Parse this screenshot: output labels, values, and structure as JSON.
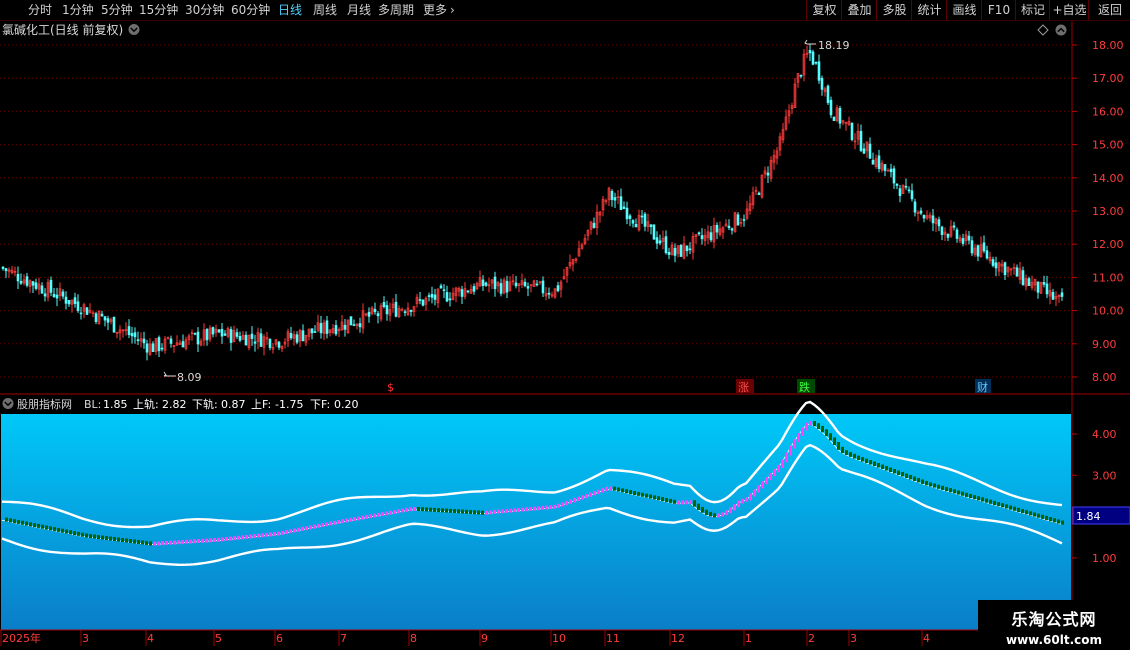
{
  "toolbar": {
    "periods": [
      "分时",
      "1分钟",
      "5分钟",
      "15分钟",
      "30分钟",
      "60分钟",
      "日线",
      "周线",
      "月线",
      "多周期",
      "更多"
    ],
    "active_period": "日线",
    "right_buttons": [
      "复权",
      "叠加",
      "多股",
      "统计",
      "画线",
      "F10",
      "标记",
      "+自选",
      "返回"
    ]
  },
  "main_chart": {
    "title": "氯碱化工(日线 前复权)",
    "high_label": "18.19",
    "low_label": "8.09",
    "y_ticks": [
      "18.00",
      "17.00",
      "16.00",
      "15.00",
      "14.00",
      "13.00",
      "12.00",
      "11.00",
      "10.00",
      "9.00",
      "8.00"
    ],
    "markers": [
      "$",
      "涨",
      "跌",
      "财"
    ],
    "up_color": "#ff3c3c",
    "down_color": "#54fcfc"
  },
  "indicator": {
    "name": "股朋指标网",
    "bl_label": "BL:",
    "bl_value": "1.85",
    "upper_label": "上轨:",
    "upper_value": "2.82",
    "lower_label": "下轨:",
    "lower_value": "0.87",
    "upf_label": "上F:",
    "upf_value": "-1.75",
    "downf_label": "下F:",
    "downf_value": "0.20",
    "y_ticks": [
      "4.00",
      "3.00",
      "1.00"
    ],
    "current_value": "1.84",
    "brick_up_color": "#ff40ff",
    "brick_down_color": "#006400",
    "bg_top": "#00c8f8",
    "bg_bottom": "#0a7ec8"
  },
  "x_axis": {
    "labels": [
      "2025年",
      "3",
      "4",
      "5",
      "6",
      "7",
      "8",
      "9",
      "10",
      "11",
      "12",
      "1",
      "2",
      "3",
      "4"
    ]
  },
  "watermark": {
    "name": "乐淘公式网",
    "url": "www.60lt.com"
  },
  "chart_data": {
    "type": "candlestick",
    "title": "氯碱化工(日线 前复权)",
    "y_range": [
      8.0,
      18.0
    ],
    "close_path": [
      {
        "month": "2025年",
        "close": 11.3
      },
      {
        "month": "3",
        "close": 10.1
      },
      {
        "month": "4",
        "close": 8.9
      },
      {
        "month": "5",
        "close": 9.3
      },
      {
        "month": "6",
        "close": 9.1
      },
      {
        "month": "7",
        "close": 9.6
      },
      {
        "month": "8",
        "close": 10.2
      },
      {
        "month": "9",
        "close": 10.8
      },
      {
        "month": "10",
        "close": 10.6
      },
      {
        "month": "11",
        "close": 13.5
      },
      {
        "month": "12",
        "close": 11.7
      },
      {
        "month": "1",
        "close": 12.9
      },
      {
        "month": "2",
        "close": 16.8
      },
      {
        "month": "3",
        "close": 15.3
      },
      {
        "month": "4",
        "close": 12.8
      }
    ],
    "high": 18.19,
    "low": 8.09,
    "indicator_series": [
      {
        "month": "2025年",
        "value": 1.95
      },
      {
        "month": "3",
        "value": 1.55
      },
      {
        "month": "4",
        "value": 1.35
      },
      {
        "month": "5",
        "value": 1.45
      },
      {
        "month": "6",
        "value": 1.6
      },
      {
        "month": "7",
        "value": 1.9
      },
      {
        "month": "8",
        "value": 2.2
      },
      {
        "month": "9",
        "value": 2.1
      },
      {
        "month": "10",
        "value": 2.25
      },
      {
        "month": "11",
        "value": 2.7
      },
      {
        "month": "12",
        "value": 2.35
      },
      {
        "month": "1",
        "value": 2.4
      },
      {
        "month": "2",
        "value": 3.95
      },
      {
        "month": "3",
        "value": 3.45
      },
      {
        "month": "4",
        "value": 2.8
      }
    ],
    "indicator_last": 1.84
  }
}
